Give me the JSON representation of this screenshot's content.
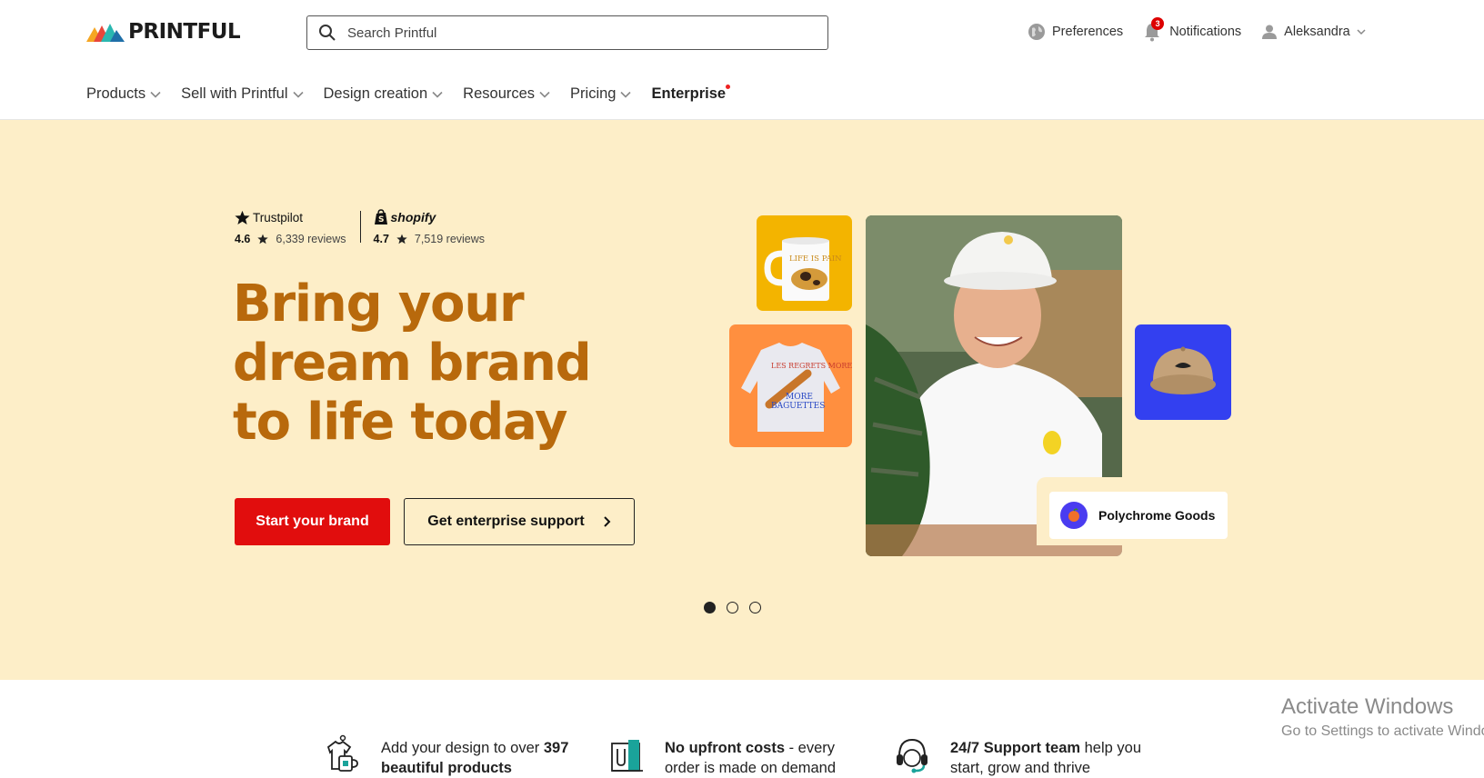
{
  "header": {
    "logo_text": "PRINTFUL",
    "search_placeholder": "Search Printful",
    "preferences_label": "Preferences",
    "notifications_label": "Notifications",
    "notifications_count": "3",
    "user_name": "Aleksandra"
  },
  "nav": {
    "items": [
      {
        "label": "Products"
      },
      {
        "label": "Sell with Printful"
      },
      {
        "label": "Design creation"
      },
      {
        "label": "Resources"
      },
      {
        "label": "Pricing"
      },
      {
        "label": "Enterprise"
      }
    ]
  },
  "hero": {
    "trustpilot": {
      "brand": "Trustpilot",
      "score": "4.6",
      "reviews": "6,339 reviews"
    },
    "shopify": {
      "brand": "shopify",
      "score": "4.7",
      "reviews": "7,519 reviews"
    },
    "title": "Bring your dream brand to life today",
    "primary_button": "Start your brand",
    "secondary_button": "Get enterprise support",
    "mug_text": "LIFE IS PAIN",
    "sweatshirt_text": "LES REGRETS MORE BAGUETTES",
    "store_name": "Polychrome Goods",
    "carousel": {
      "total": 3,
      "active": 1
    },
    "colors": {
      "background": "#fdeec8",
      "title": "#b8690c",
      "primary": "#e10d0d"
    }
  },
  "features": [
    {
      "prefix": "Add your design to over ",
      "bold": "397 beautiful products",
      "suffix": ""
    },
    {
      "prefix": "",
      "bold": "No upfront costs",
      "suffix": " - every order is made on demand"
    },
    {
      "prefix": "",
      "bold": "24/7 Support team",
      "suffix": " help you start, grow and thrive"
    }
  ],
  "watermark": {
    "title": "Activate Windows",
    "subtitle": "Go to Settings to activate Windows."
  }
}
